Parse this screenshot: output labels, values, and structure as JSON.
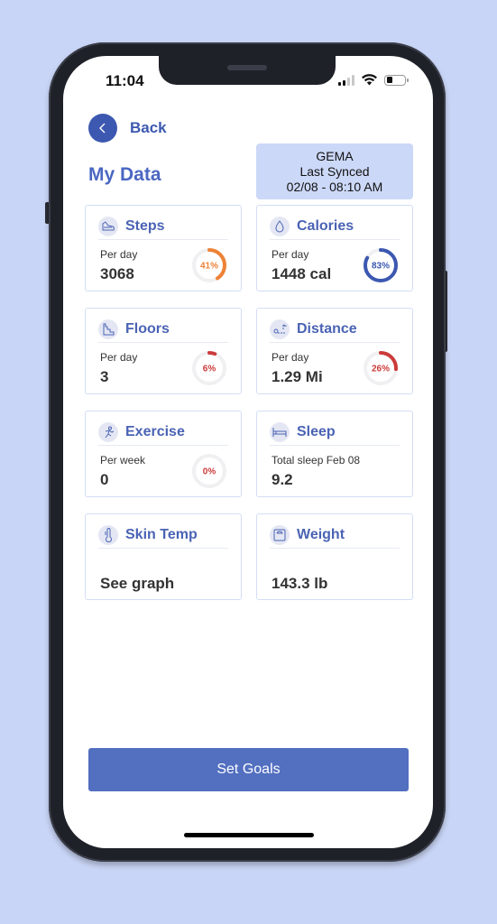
{
  "status_bar": {
    "time": "11:04",
    "signal_bars": 2,
    "signal_bars_total": 4,
    "battery_level_percent": 25
  },
  "nav": {
    "back_label": "Back",
    "back_icon": "chevron-left-icon"
  },
  "header": {
    "title": "My Data"
  },
  "sync": {
    "device": "GEMA",
    "label": "Last Synced",
    "datetime": "02/08 - 08:10 AM"
  },
  "cards": [
    {
      "title": "Steps",
      "icon": "shoe-icon",
      "sub": "Per day",
      "value": "3068",
      "progress": 41,
      "progress_label": "41%",
      "ring_color": "#ee8236"
    },
    {
      "title": "Calories",
      "icon": "flame-icon",
      "sub": "Per day",
      "value": "1448 cal",
      "progress": 83,
      "progress_label": "83%",
      "ring_color": "#3c58b0"
    },
    {
      "title": "Floors",
      "icon": "stairs-icon",
      "sub": "Per day",
      "value": "3",
      "progress": 6,
      "progress_label": "6%",
      "ring_color": "#cc3b3b"
    },
    {
      "title": "Distance",
      "icon": "route-icon",
      "sub": "Per day",
      "value": "1.29 Mi",
      "progress": 26,
      "progress_label": "26%",
      "ring_color": "#cc3b3b"
    },
    {
      "title": "Exercise",
      "icon": "running-icon",
      "sub": "Per week",
      "value": "0",
      "progress": 0,
      "progress_label": "0%",
      "ring_color": "#cc3b3b"
    },
    {
      "title": "Sleep",
      "icon": "bed-icon",
      "sub": "Total sleep Feb 08",
      "value": "9.2"
    },
    {
      "title": "Skin Temp",
      "icon": "thermometer-icon",
      "sub": "",
      "value": "See graph"
    },
    {
      "title": "Weight",
      "icon": "scale-icon",
      "sub": "",
      "value": "143.3 lb"
    }
  ],
  "footer": {
    "set_goals_label": "Set Goals"
  },
  "colors": {
    "accent": "#526fc0",
    "title": "#4a67c2",
    "sync_bg": "#ccd8f7",
    "background": "#c9d5f6"
  }
}
